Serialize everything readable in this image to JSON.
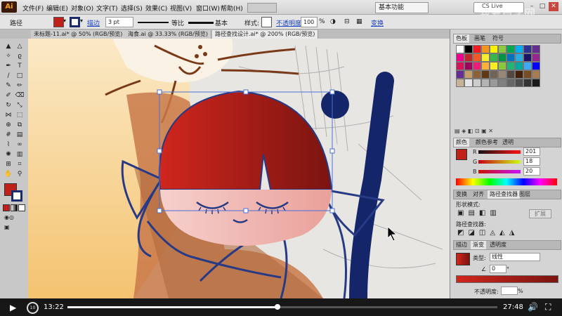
{
  "menubar": {
    "logo": "Ai",
    "items": [
      "文件(F)",
      "编辑(E)",
      "对象(O)",
      "文字(T)",
      "选择(S)",
      "效果(C)",
      "视图(V)",
      "窗口(W)",
      "帮助(H)"
    ],
    "workspace": "基本功能",
    "cs_live": "CS Live"
  },
  "watermark": "我爱自学网",
  "control_bar": {
    "selection_label": "路径",
    "stroke_link": "描边",
    "stroke_weight": "3 pt",
    "profile_1": "等比",
    "profile_2": "基本",
    "style_label": "样式:",
    "opacity_label": "不透明度:",
    "opacity_value": "100",
    "opacity_unit": "%",
    "transform_link": "变换",
    "fill_color": "#c0201a",
    "stroke_color": "#1a2a6a"
  },
  "tabs": [
    {
      "label": "未标题-11.ai* @ 50% (RGB/预览)",
      "active": false
    },
    {
      "label": "海食.ai @ 33.33% (RGB/预览)",
      "active": false
    },
    {
      "label": "路径查找设计.ai* @ 200% (RGB/预览)",
      "active": true
    }
  ],
  "tools": [
    [
      "selection-tool",
      "▲"
    ],
    [
      "direct-selection-tool",
      "△"
    ],
    [
      "magic-wand-tool",
      "✧"
    ],
    [
      "lasso-tool",
      "ϱ"
    ],
    [
      "pen-tool",
      "✒"
    ],
    [
      "type-tool",
      "T"
    ],
    [
      "line-tool",
      "/"
    ],
    [
      "rectangle-tool",
      "□"
    ],
    [
      "paintbrush-tool",
      "✎"
    ],
    [
      "pencil-tool",
      "✏"
    ],
    [
      "blob-brush-tool",
      "✐"
    ],
    [
      "eraser-tool",
      "⌫"
    ],
    [
      "rotate-tool",
      "↻"
    ],
    [
      "scale-tool",
      "⤡"
    ],
    [
      "width-tool",
      "⋈"
    ],
    [
      "free-transform-tool",
      "⬚"
    ],
    [
      "shape-builder-tool",
      "⊕"
    ],
    [
      "perspective-tool",
      "⧉"
    ],
    [
      "mesh-tool",
      "#"
    ],
    [
      "gradient-tool",
      "▤"
    ],
    [
      "eyedropper-tool",
      "⌇"
    ],
    [
      "blend-tool",
      "∞"
    ],
    [
      "symbol-sprayer-tool",
      "✺"
    ],
    [
      "column-graph-tool",
      "▥"
    ],
    [
      "artboard-tool",
      "⊞"
    ],
    [
      "slice-tool",
      "⌗"
    ],
    [
      "hand-tool",
      "✋"
    ],
    [
      "zoom-tool",
      "⚲"
    ]
  ],
  "tool_colors": {
    "fill": "#c0201a",
    "stroke": "#1a2a6a"
  },
  "panels": {
    "swatch_tabs": [
      "色板",
      "画笔",
      "符号"
    ],
    "color_tabs": [
      "颜色",
      "颜色参考",
      "透明"
    ],
    "color_values": {
      "R": "201",
      "G": "18",
      "B": "20"
    },
    "pathfinder_tabs": [
      "变换",
      "对齐",
      "路径查找器",
      "图层"
    ],
    "shape_modes_label": "形状模式:",
    "expand_button": "扩展",
    "pathfinders_label": "路径查找器:",
    "gradient_tabs": [
      "描边",
      "渐变",
      "透明度"
    ],
    "gradient_type_label": "类型:",
    "gradient_type": "线性",
    "angle_value": "0",
    "angle_unit": "°",
    "opacity_label": "不透明度:",
    "opacity_unit": "%"
  },
  "swatch_colors": [
    "#ffffff",
    "#000000",
    "#ed1c24",
    "#f7941d",
    "#fff200",
    "#8dc63f",
    "#00a651",
    "#00aeef",
    "#2e3192",
    "#662d91",
    "#ec008c",
    "#c1272d",
    "#f15a24",
    "#f9ed32",
    "#39b54a",
    "#009245",
    "#0071bc",
    "#29abe2",
    "#1b1464",
    "#93278f",
    "#d4145a",
    "#9e005d",
    "#ed1e79",
    "#fbb03b",
    "#fcee21",
    "#8cc63f",
    "#22b573",
    "#00a99d",
    "#3fa9f5",
    "#0000ff",
    "#662d91",
    "#c69c6d",
    "#8c6239",
    "#603813",
    "#736357",
    "#998675",
    "#534741",
    "#42210b",
    "#754c24",
    "#a67c52",
    "#c7b299",
    "#e6e6e6",
    "#cccccc",
    "#b3b3b3",
    "#999999",
    "#808080",
    "#666666",
    "#4d4d4d",
    "#333333",
    "#1a1a1a"
  ],
  "video": {
    "current_time": "13:22",
    "total_time": "27:48",
    "progress": 0.488
  }
}
